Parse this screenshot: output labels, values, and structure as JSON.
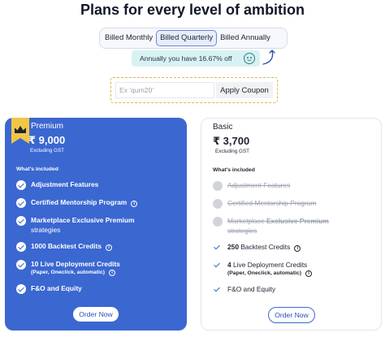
{
  "header": {
    "title": "Plans for every level of ambition"
  },
  "billing": {
    "options": [
      "Billed Monthly",
      "Billed Quarterly",
      "Billed Annually"
    ],
    "selected": "Billed Quarterly",
    "savings_text": "Annually you have 16.67% off"
  },
  "coupon": {
    "placeholder": "Ex 'qum20'",
    "value": "",
    "button_label": "Apply Coupon"
  },
  "plans": [
    {
      "name": "Premium",
      "price": "₹ 9,000",
      "price_note": "Excluding GST",
      "included_label": "What's included",
      "order_label": "Order Now",
      "features": [
        {
          "text": "Adjustment Features"
        },
        {
          "text": "Certified Mentorship Program",
          "info": true
        },
        {
          "text": "Marketplace Exclusive Premium",
          "sub": "strategies"
        },
        {
          "text": "1000 Backtest Credits",
          "info": true
        },
        {
          "text": "10 Live Deployment Credits",
          "sub": "(Paper, Oneclick, automatic)",
          "info": true
        },
        {
          "text": "F&O and Equity"
        }
      ]
    },
    {
      "name": "Basic",
      "price": "₹ 3,700",
      "price_note": "Excluding GST",
      "included_label": "What's included",
      "order_label": "Order Now",
      "features": [
        {
          "text": "Adjustment Features",
          "included": false
        },
        {
          "text": "Certified Mentorship Program",
          "included": false
        },
        {
          "text": "Marketplace",
          "bold": "Exclusive Premium",
          "sub": "strategies",
          "included": false
        },
        {
          "bold": "250",
          "text": "Backtest Credits",
          "included": true,
          "info": true
        },
        {
          "bold": "4",
          "text": "Live Deployment Credits",
          "sub": "(Paper, Oneclick, automatic)",
          "included": true,
          "info": true
        },
        {
          "text": "F&O and Equity",
          "included": true
        }
      ]
    }
  ],
  "colors": {
    "premium_bg": "#3b67d1",
    "accent": "#3b67d1",
    "crown_flag": "#f1c645",
    "savings_bg": "#d7f2f3",
    "coupon_border": "#e3b54a"
  },
  "icons": {
    "crown": "crown-icon",
    "check": "check-circle-icon",
    "info": "info-icon",
    "smile": "smiley-icon",
    "arrow": "curved-arrow-icon"
  }
}
